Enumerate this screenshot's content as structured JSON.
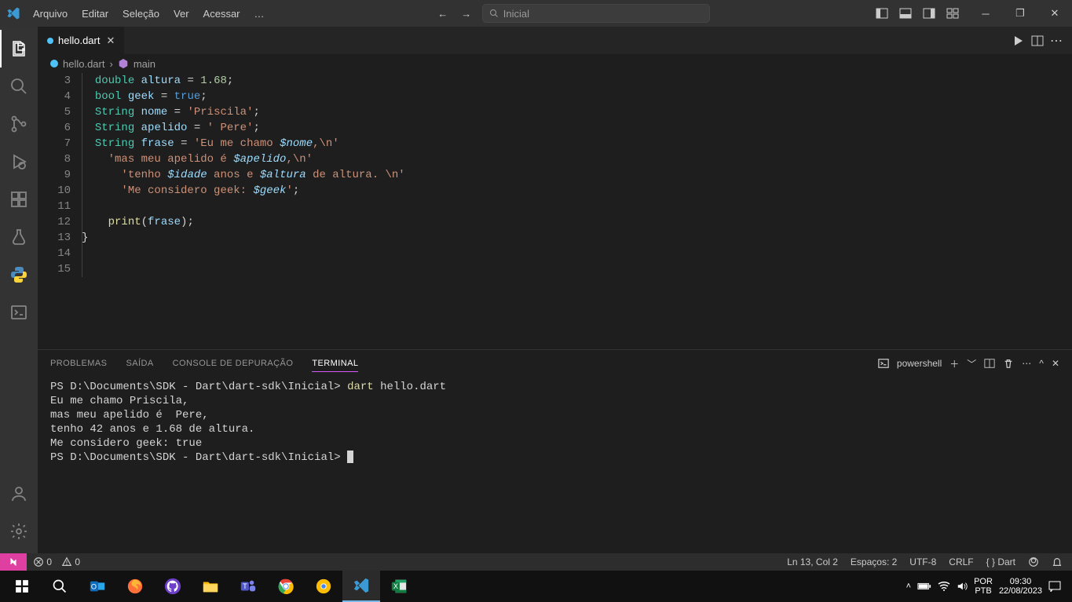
{
  "menubar": {
    "items": [
      "Arquivo",
      "Editar",
      "Seleção",
      "Ver",
      "Acessar",
      "…"
    ]
  },
  "search": {
    "placeholder": "Inicial"
  },
  "tab": {
    "filename": "hello.dart"
  },
  "breadcrumb": {
    "file": "hello.dart",
    "symbol": "main"
  },
  "code": {
    "lines": [
      {
        "n": 3,
        "indent": 1,
        "html": "<span class='tp'>double</span> <span class='id'>altura</span> <span class='op'>=</span> <span class='num'>1.68</span><span class='pun'>;</span>"
      },
      {
        "n": 4,
        "indent": 1,
        "html": "<span class='tp'>bool</span> <span class='id'>geek</span> <span class='op'>=</span> <span class='boo'>true</span><span class='pun'>;</span>"
      },
      {
        "n": 5,
        "indent": 1,
        "html": "<span class='tp'>String</span> <span class='id'>nome</span> <span class='op'>=</span> <span class='str'>'Priscila'</span><span class='pun'>;</span>"
      },
      {
        "n": 6,
        "indent": 1,
        "html": "<span class='tp'>String</span> <span class='id'>apelido</span> <span class='op'>=</span> <span class='str'>' Pere'</span><span class='pun'>;</span>"
      },
      {
        "n": 7,
        "indent": 1,
        "html": "<span class='tp'>String</span> <span class='id'>frase</span> <span class='op'>=</span> <span class='str'>'Eu me chamo <span class='intp'>$nome</span>,\\n'</span>"
      },
      {
        "n": 8,
        "indent": 2,
        "html": "<span class='str'>'mas meu apelido é <span class='intp'>$apelido</span>,\\n'</span>"
      },
      {
        "n": 9,
        "indent": 3,
        "html": "<span class='str'>'tenho <span class='intp'>$idade</span> anos e <span class='intp'>$altura</span> de altura. \\n'</span>"
      },
      {
        "n": 10,
        "indent": 3,
        "html": "<span class='str'>'Me considero geek: <span class='intp'>$geek</span>'</span><span class='pun'>;</span>"
      },
      {
        "n": 11,
        "indent": 0,
        "html": ""
      },
      {
        "n": 12,
        "indent": 2,
        "html": "<span class='fn'>print</span><span class='pun'>(</span><span class='id'>frase</span><span class='pun'>)</span><span class='pun'>;</span>"
      },
      {
        "n": 13,
        "indent": 0,
        "html": "<span class='pun'>}</span>"
      },
      {
        "n": 14,
        "indent": 0,
        "html": ""
      },
      {
        "n": 15,
        "indent": 0,
        "html": ""
      }
    ]
  },
  "panel": {
    "tabs": [
      "PROBLEMAS",
      "SAÍDA",
      "CONSOLE DE DEPURAÇÃO",
      "TERMINAL"
    ],
    "active_tab": 3,
    "shell_label": "powershell"
  },
  "terminal": {
    "lines": [
      {
        "type": "prompt_cmd",
        "prompt": "PS D:\\Documents\\SDK - Dart\\dart-sdk\\Inicial> ",
        "cmd": "dart",
        "arg": " hello.dart"
      },
      {
        "type": "out",
        "text": "Eu me chamo Priscila,"
      },
      {
        "type": "out",
        "text": "mas meu apelido é  Pere,"
      },
      {
        "type": "out",
        "text": "tenho 42 anos e 1.68 de altura."
      },
      {
        "type": "out",
        "text": "Me considero geek: true"
      },
      {
        "type": "prompt",
        "prompt": "PS D:\\Documents\\SDK - Dart\\dart-sdk\\Inicial> "
      }
    ]
  },
  "status": {
    "errors": "0",
    "warnings": "0",
    "cursor": "Ln 13, Col 2",
    "spaces": "Espaços: 2",
    "encoding": "UTF-8",
    "eol": "CRLF",
    "lang": "Dart"
  },
  "tray": {
    "lang1": "POR",
    "lang2": "PTB",
    "time": "09:30",
    "date": "22/08/2023"
  }
}
